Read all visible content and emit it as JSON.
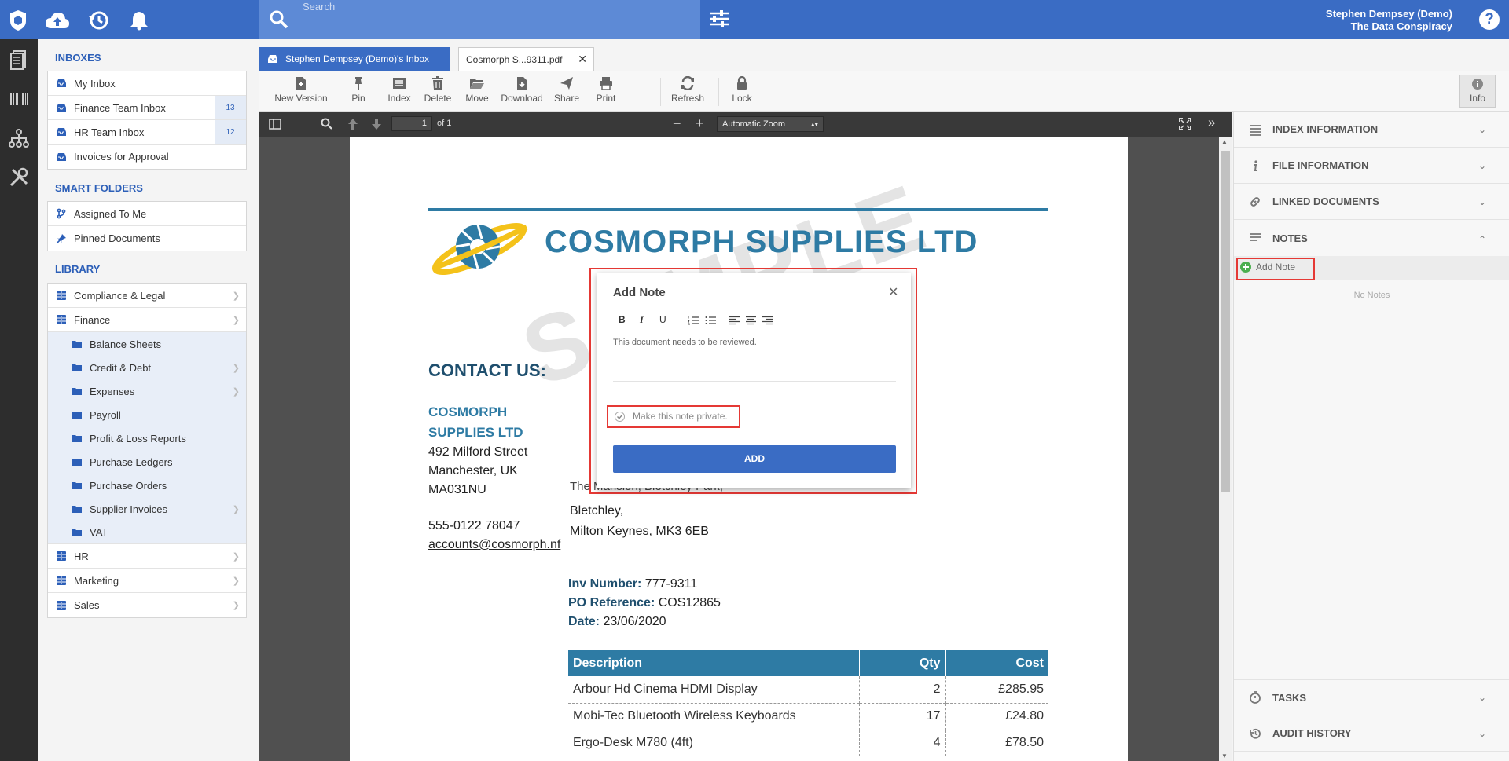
{
  "header": {
    "search_placeholder": "Search",
    "user_name": "Stephen Dempsey (Demo)",
    "org_name": "The Data Conspiracy",
    "help_label": "?"
  },
  "sidebar": {
    "inboxes_title": "INBOXES",
    "inboxes": [
      {
        "label": "My Inbox",
        "badge": ""
      },
      {
        "label": "Finance Team Inbox",
        "badge": "13"
      },
      {
        "label": "HR Team Inbox",
        "badge": "12"
      },
      {
        "label": "Invoices for Approval",
        "badge": ""
      }
    ],
    "smart_title": "SMART FOLDERS",
    "smart": [
      {
        "label": "Assigned To Me"
      },
      {
        "label": "Pinned Documents"
      }
    ],
    "library_title": "LIBRARY",
    "library_top": [
      {
        "label": "Compliance & Legal"
      },
      {
        "label": "Finance"
      }
    ],
    "finance_children": [
      {
        "label": "Balance Sheets"
      },
      {
        "label": "Credit & Debt"
      },
      {
        "label": "Expenses"
      },
      {
        "label": "Payroll"
      },
      {
        "label": "Profit & Loss Reports"
      },
      {
        "label": "Purchase Ledgers"
      },
      {
        "label": "Purchase Orders"
      },
      {
        "label": "Supplier Invoices"
      },
      {
        "label": "VAT"
      }
    ],
    "library_bottom": [
      {
        "label": "HR"
      },
      {
        "label": "Marketing"
      },
      {
        "label": "Sales"
      }
    ]
  },
  "tabs": [
    {
      "label": "Stephen Dempsey (Demo)'s Inbox"
    },
    {
      "label": "Cosmorph S...9311.pdf"
    }
  ],
  "toolbar": [
    {
      "label": "New Version"
    },
    {
      "label": "Pin"
    },
    {
      "label": "Index"
    },
    {
      "label": "Delete"
    },
    {
      "label": "Move"
    },
    {
      "label": "Download"
    },
    {
      "label": "Share"
    },
    {
      "label": "Print"
    },
    {
      "label": "Refresh"
    },
    {
      "label": "Lock"
    },
    {
      "label": "Info"
    }
  ],
  "viewer": {
    "page_value": "1",
    "page_total": "of 1",
    "zoom_value": "Automatic Zoom"
  },
  "document": {
    "company_name": "COSMORPH SUPPLIES LTD",
    "watermark": "SAMPLE",
    "contact_heading": "CONTACT US:",
    "contact_company": [
      "COSMORPH",
      "SUPPLIES LTD"
    ],
    "contact_address": [
      "492 Milford Street",
      "Manchester, UK",
      "MA031NU"
    ],
    "contact_phone": "555-0122 78047",
    "contact_email": "accounts@cosmorph.nf",
    "bill_partial": "The Mansion, Bletchley Park,",
    "bill_lines": [
      "Bletchley,",
      "Milton Keynes, MK3 6EB"
    ],
    "inv_label": "Inv Number:",
    "inv_value": "777-9311",
    "po_label": "PO Reference:",
    "po_value": "COS12865",
    "date_label": "Date:",
    "date_value": "23/06/2020",
    "table_headers": [
      "Description",
      "Qty",
      "Cost"
    ],
    "table_rows": [
      [
        "Arbour Hd Cinema HDMI Display",
        "2",
        "£285.95"
      ],
      [
        "Mobi-Tec Bluetooth Wireless Keyboards",
        "17",
        "£24.80"
      ],
      [
        "Ergo-Desk M780 (4ft)",
        "4",
        "£78.50"
      ]
    ]
  },
  "modal": {
    "title": "Add Note",
    "body_text": "This document needs to be reviewed.",
    "private_label": "Make this note private.",
    "add_label": "ADD",
    "format_buttons": [
      "B",
      "I",
      "U"
    ]
  },
  "right_panel": {
    "sections_top": [
      {
        "label": "INDEX INFORMATION"
      },
      {
        "label": "FILE INFORMATION"
      },
      {
        "label": "LINKED DOCUMENTS"
      },
      {
        "label": "NOTES"
      }
    ],
    "add_note_label": "Add Note",
    "empty_notes": "No Notes",
    "sections_bottom": [
      {
        "label": "TASKS"
      },
      {
        "label": "AUDIT HISTORY"
      }
    ]
  },
  "colors": {
    "brand_blue": "#3a6cc4",
    "highlight_red": "#e53935",
    "doc_teal": "#2e7ba4",
    "add_green": "#4caf50"
  }
}
